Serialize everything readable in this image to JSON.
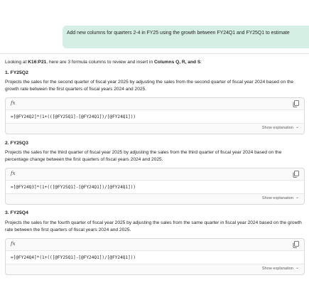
{
  "user_message": "Add new columns for quarters 2-4 in FY25 using the growth between FY24Q1 and FY25Q1 to estimate",
  "response": {
    "intro_prefix": "Looking at ",
    "intro_range": "K16:P21",
    "intro_middle": ", here are 3 formula columns to review and insert in ",
    "intro_columns": "Columns Q, R, and S",
    "intro_suffix": ":",
    "fx_label": "fx",
    "show_explanation": "Show explanation",
    "sections": [
      {
        "title": "1. FY25Q2",
        "description": "Projects the sales for the second quarter of fiscal year 2025 by adjusting the sales from the second quarter of fiscal year 2024 based on the growth rate between the first quarters of fiscal years 2024 and 2025.",
        "formula": "=[@FY24Q2]*(1+(([@FY25Q1]-[@FY24Q1])/[@FY24Q1]))"
      },
      {
        "title": "2. FY25Q3",
        "description": "Projects the sales for the third quarter of fiscal year 2025 by adjusting the sales from the third quarter of fiscal year 2024 based on the percentage change between the first quarters of fiscal years 2024 and 2025.",
        "formula": "=[@FY24Q3]*(1+(([@FY25Q1]-[@FY24Q1])/[@FY24Q1]))"
      },
      {
        "title": "3. FY25Q4",
        "description": "Projects the sales for the fourth quarter of fiscal year 2025 by adjusting the sales from the same quarter in fiscal year 2024 based on the growth rate between the first quarters of fiscal years 2024 and 2025.",
        "formula": "=[@FY24Q4]*(1+(([@FY25Q1]-[@FY24Q1])/[@FY24Q1]))"
      }
    ]
  },
  "colors": {
    "user_bubble": "#d6efe5",
    "card_background": "#fafafa",
    "text": "#242424",
    "muted": "#616161"
  }
}
